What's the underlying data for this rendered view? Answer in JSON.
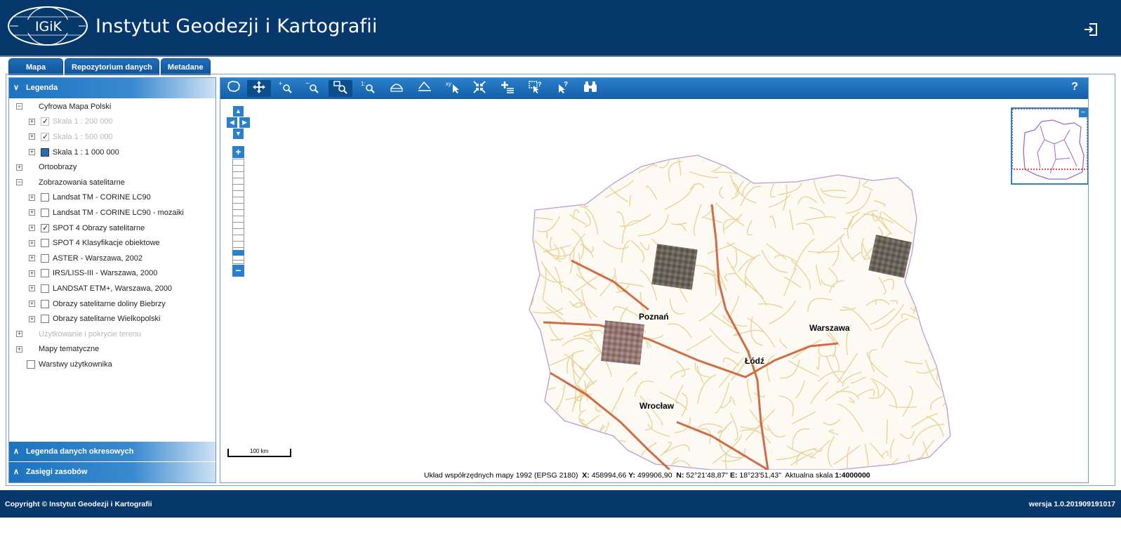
{
  "header": {
    "title": "Instytut Geodezji i Kartografii",
    "logo_text": "IGiK",
    "logout_icon": "logout-icon"
  },
  "tabs": [
    {
      "label": "Mapa"
    },
    {
      "label": "Repozytorium danych"
    },
    {
      "label": "Metadane"
    }
  ],
  "legend": {
    "title": "Legenda",
    "items": [
      {
        "label": "Cyfrowa Mapa Polski"
      },
      {
        "label": "Skala 1 : 200 000"
      },
      {
        "label": "Skala 1 : 500 000"
      },
      {
        "label": "Skala 1 : 1 000 000"
      },
      {
        "label": "Ortoobrazy"
      },
      {
        "label": "Zobrazowania satelitarne"
      },
      {
        "label": "Landsat TM - CORINE LC90"
      },
      {
        "label": "Landsat TM - CORINE LC90 - mozaiki"
      },
      {
        "label": "SPOT 4 Obrazy satelitarne"
      },
      {
        "label": "SPOT 4 Klasyfikacje obiektowe"
      },
      {
        "label": "ASTER - Warszawa, 2002"
      },
      {
        "label": "IRS/LISS-III - Warszawa, 2000"
      },
      {
        "label": "LANDSAT ETM+, Warszawa, 2000"
      },
      {
        "label": "Obrazy satelitarne doliny Biebrzy"
      },
      {
        "label": "Obrazy satelitarne Wielkopolski"
      },
      {
        "label": "Użytkowanie i pokrycie terenu"
      },
      {
        "label": "Mapy tematyczne"
      },
      {
        "label": "Warstwy użytkownika"
      }
    ],
    "bottom_sections": [
      {
        "label": "Legenda danych okresowych"
      },
      {
        "label": "Zasięgi zasobów"
      }
    ]
  },
  "map": {
    "help": "?",
    "zoom_in": "+",
    "zoom_out": "−",
    "scale_label": "100 km",
    "cities": [
      "Poznań",
      "Warszawa",
      "Łódź",
      "Wrocław"
    ],
    "coords": {
      "system": "Układ współrzędnych mapy 1992 (EPSG 2180)",
      "x_label": "X:",
      "x": "458994,66",
      "y_label": "Y:",
      "y": "499906,90",
      "n_label": "N:",
      "n": "52°21'48,87\"",
      "e_label": "E:",
      "e": "18°23'51,43\"",
      "scale_label": "Aktualna skala",
      "scale": "1:4000000"
    }
  },
  "footer": {
    "copyright": "Copyright © Instytut Geodezji i Kartografii",
    "version": "wersja 1.0.201909191017"
  },
  "colors": {
    "header": "#06386c",
    "accent": "#2c7fcb",
    "road": "#e8d39a",
    "highway": "#c8552a",
    "border": "#b89bd8"
  }
}
